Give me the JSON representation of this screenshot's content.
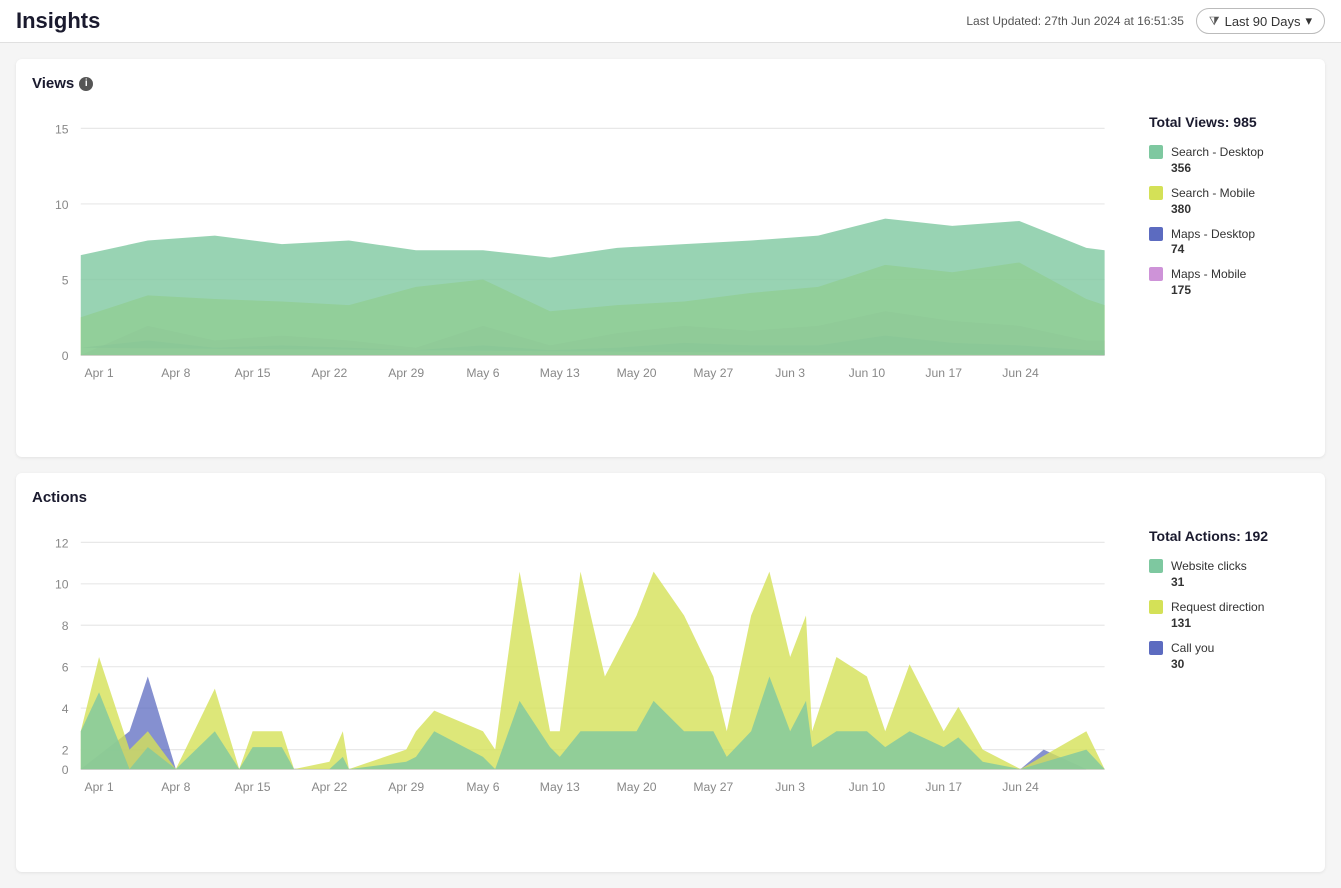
{
  "header": {
    "title": "Insights",
    "last_updated_label": "Last Updated: 27th Jun 2024 at 16:51:35",
    "filter_label": "Last 90 Days",
    "filter_icon": "▼"
  },
  "views_section": {
    "title": "Views",
    "legend_title": "Total Views: 985",
    "legend_items": [
      {
        "label": "Search - Desktop",
        "value": "356",
        "color": "#7ec8a0"
      },
      {
        "label": "Search - Mobile",
        "value": "380",
        "color": "#d4e157"
      },
      {
        "label": "Maps - Desktop",
        "value": "74",
        "color": "#5c6bc0"
      },
      {
        "label": "Maps - Mobile",
        "value": "175",
        "color": "#ce93d8"
      }
    ],
    "x_labels": [
      "Apr 1",
      "Apr 8",
      "Apr 15",
      "Apr 22",
      "Apr 29",
      "May 6",
      "May 13",
      "May 20",
      "May 27",
      "Jun 3",
      "Jun 10",
      "Jun 17",
      "Jun 24"
    ],
    "y_labels": [
      "0",
      "5",
      "10",
      "15"
    ],
    "y_max": 15
  },
  "actions_section": {
    "title": "Actions",
    "legend_title": "Total Actions: 192",
    "legend_items": [
      {
        "label": "Website clicks",
        "value": "31",
        "color": "#7ec8a0"
      },
      {
        "label": "Request direction",
        "value": "131",
        "color": "#d4e157"
      },
      {
        "label": "Call you",
        "value": "30",
        "color": "#5c6bc0"
      }
    ],
    "x_labels": [
      "Apr 1",
      "Apr 8",
      "Apr 15",
      "Apr 22",
      "Apr 29",
      "May 6",
      "May 13",
      "May 20",
      "May 27",
      "Jun 3",
      "Jun 10",
      "Jun 17",
      "Jun 24"
    ],
    "y_labels": [
      "0",
      "2",
      "4",
      "6",
      "8",
      "10",
      "12"
    ],
    "y_max": 12
  }
}
